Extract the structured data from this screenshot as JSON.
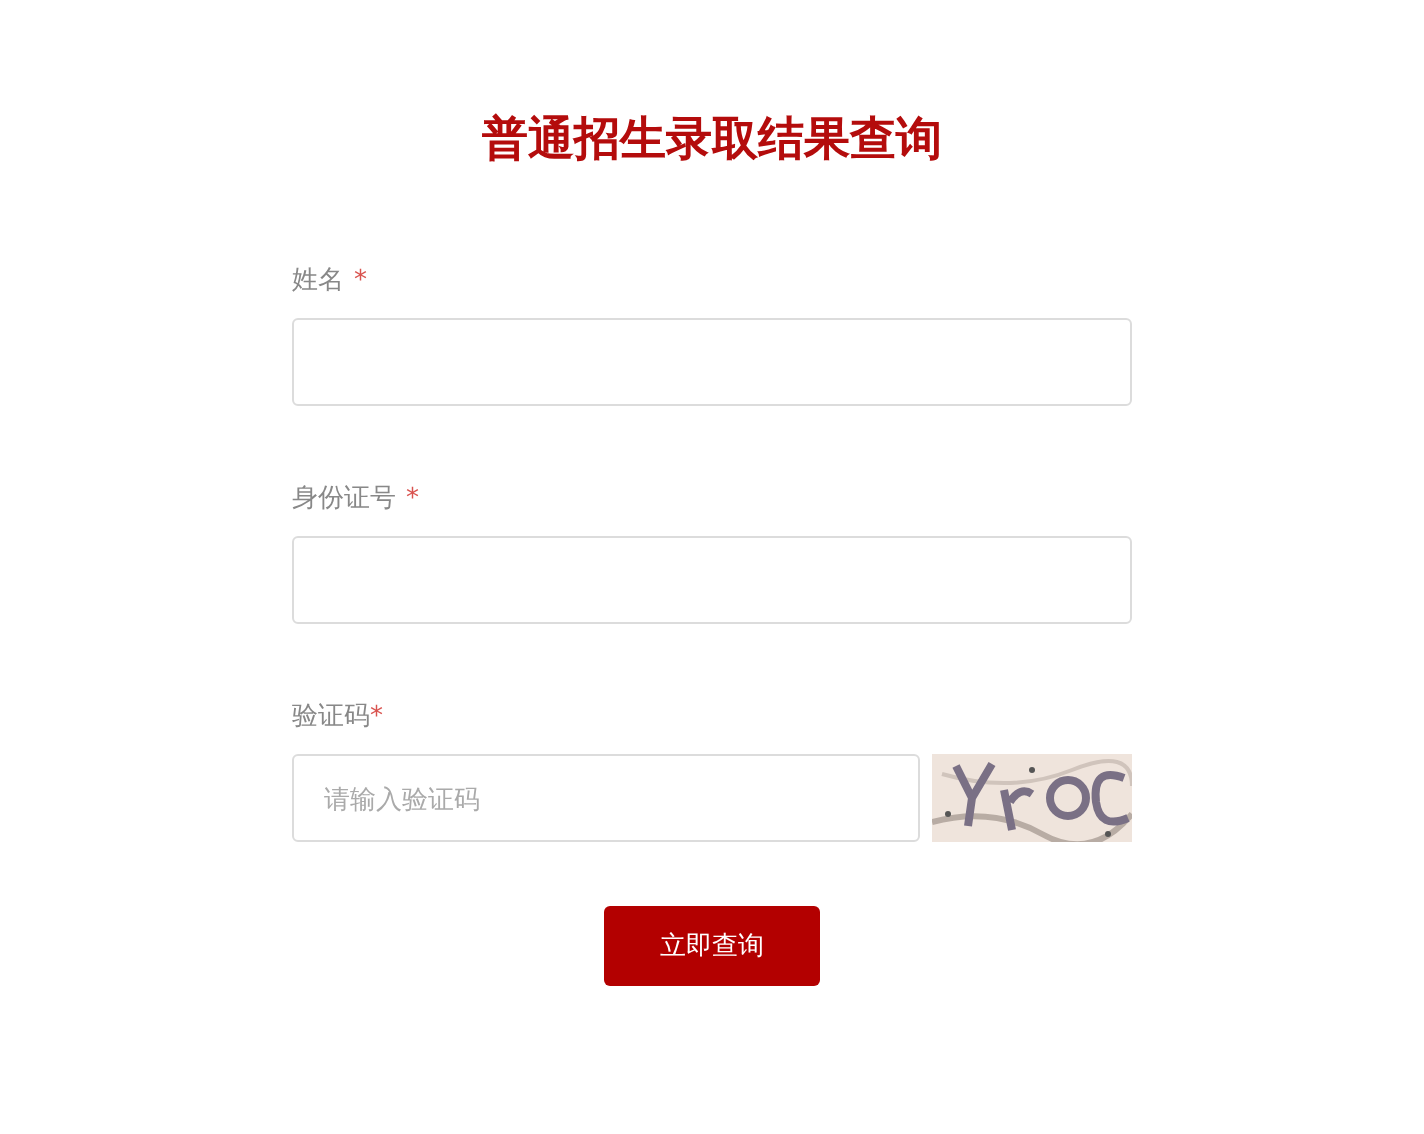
{
  "title": "普通招生录取结果查询",
  "fields": [
    {
      "kind": "text",
      "label": "姓名",
      "required_mark": "*"
    },
    {
      "kind": "text",
      "label": "身份证号",
      "required_mark": "*"
    },
    {
      "kind": "captcha",
      "label": "验证码",
      "required_mark": "*",
      "placeholder": "请输入验证码"
    }
  ],
  "submit": {
    "label": "立即查询"
  }
}
